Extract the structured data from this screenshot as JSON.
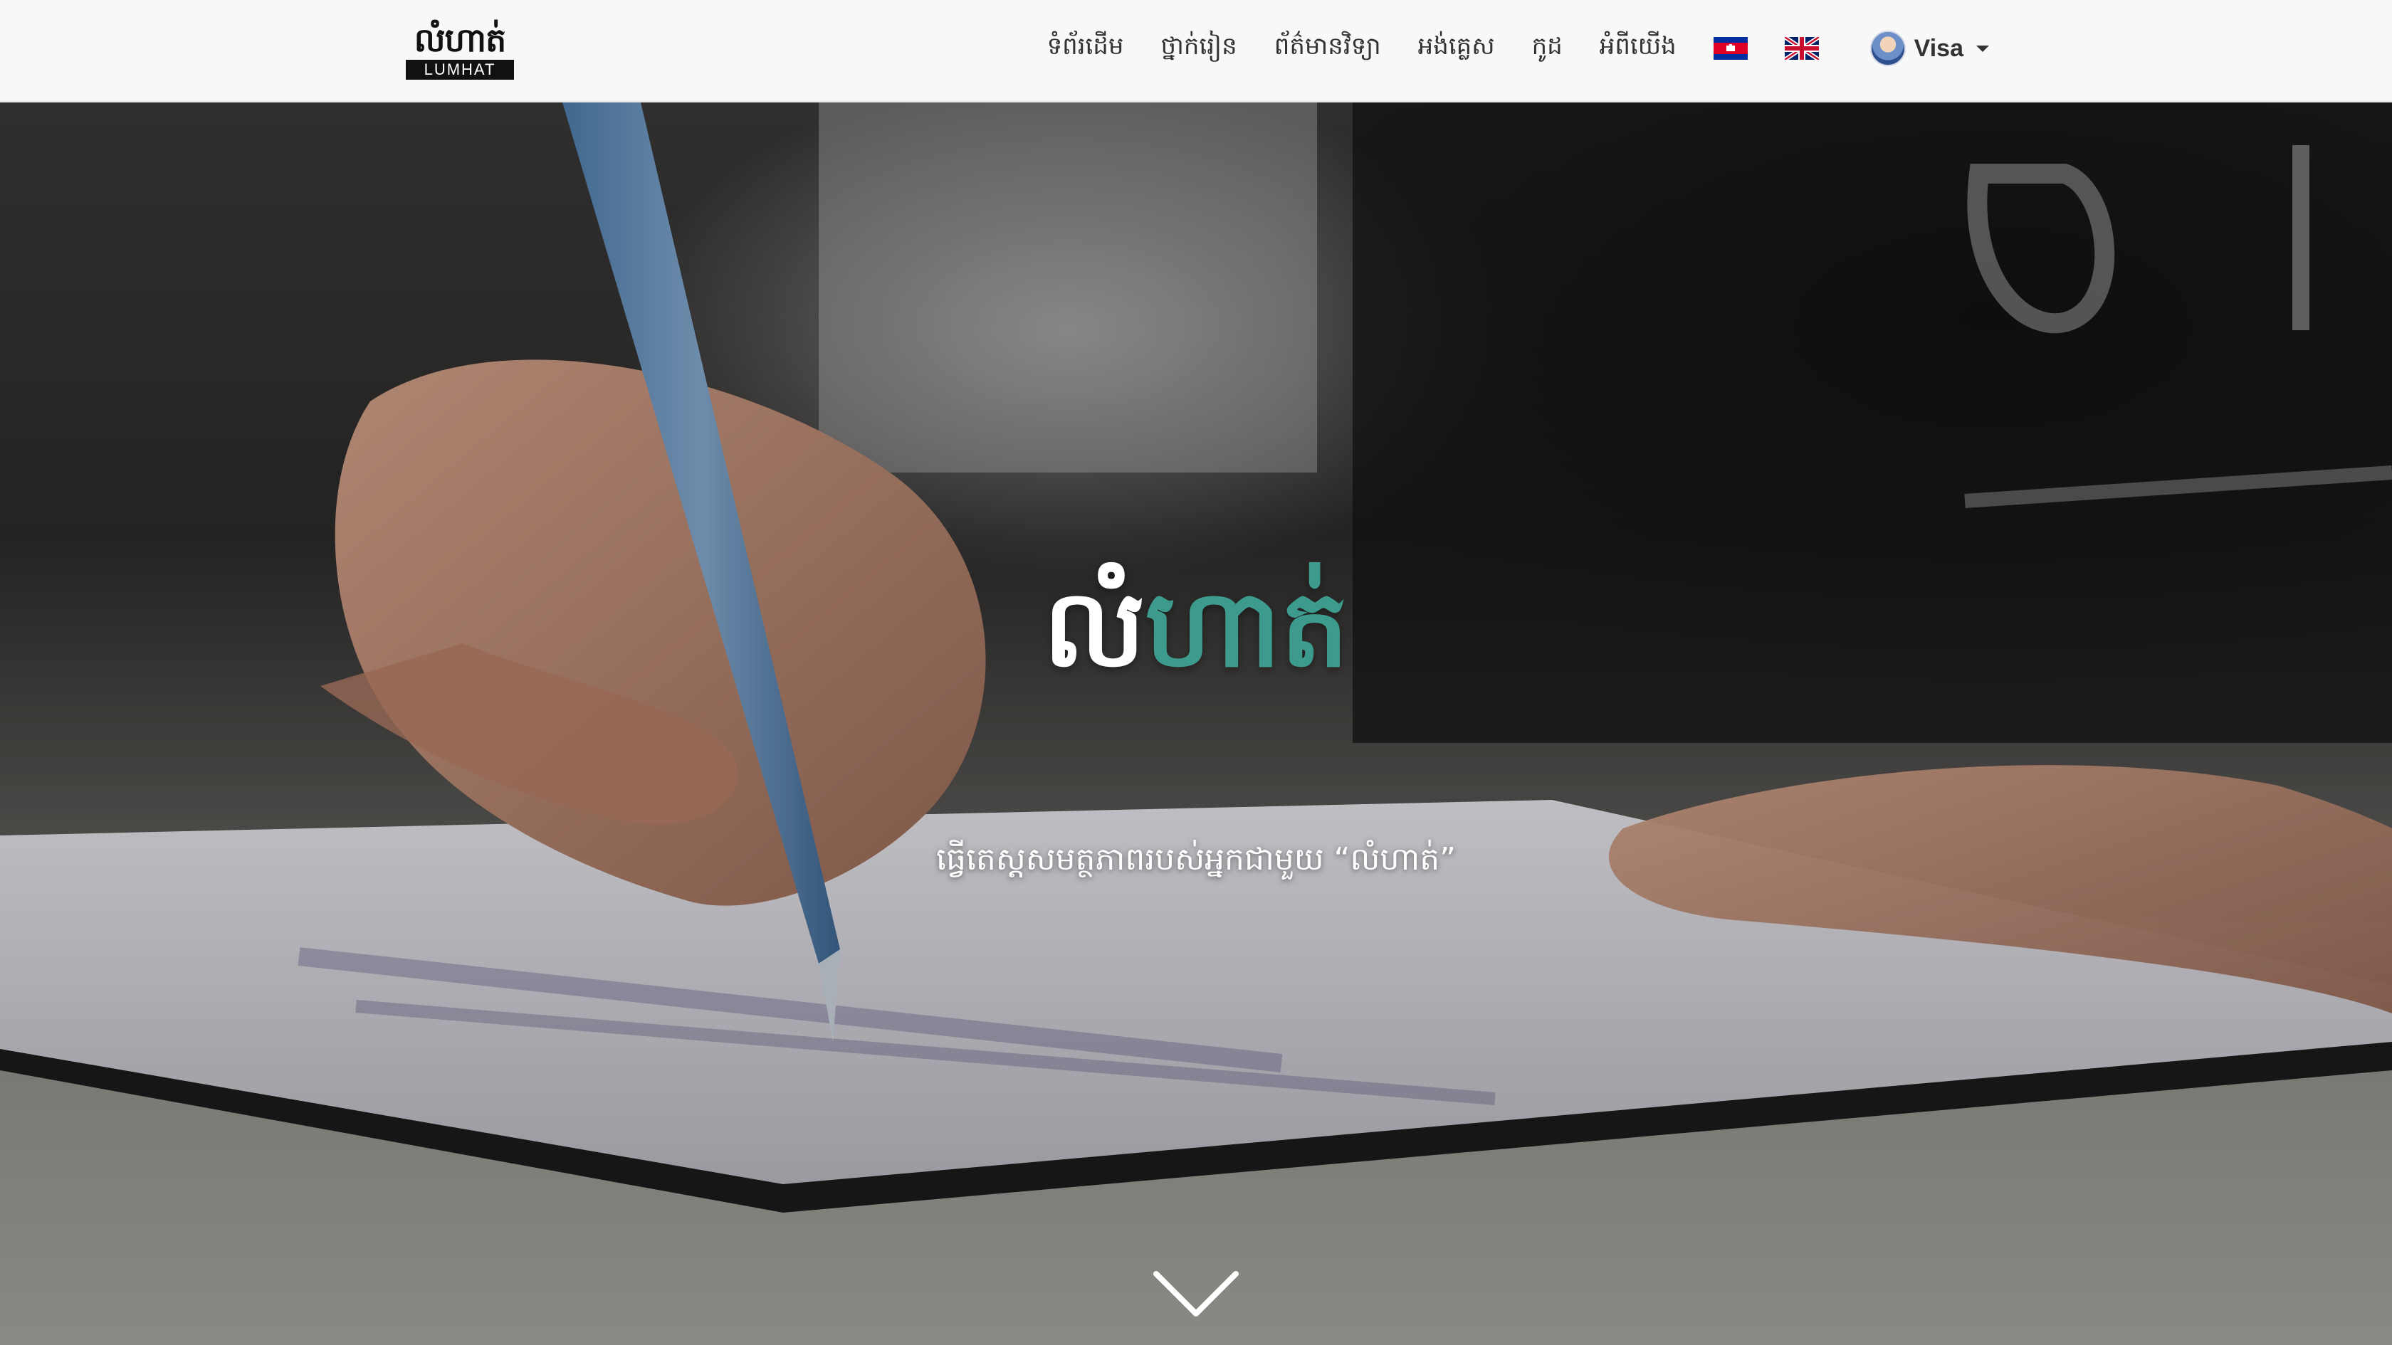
{
  "brand": {
    "logo_text": "លំហាត់",
    "logo_band": "LUMHAT"
  },
  "nav": {
    "items": [
      {
        "label": "ទំព័រដើម"
      },
      {
        "label": "ថ្នាក់រៀន"
      },
      {
        "label": "ព័ត៌មានវិទ្យា"
      },
      {
        "label": "អង់គ្លេស"
      },
      {
        "label": "កូដ"
      },
      {
        "label": "អំពីយើង"
      }
    ],
    "languages": [
      {
        "icon": "cambodia-flag-icon"
      },
      {
        "icon": "uk-flag-icon"
      }
    ],
    "user": {
      "name": "Visa",
      "icon": "chevron-down-icon"
    }
  },
  "hero": {
    "title_part1": "លំ",
    "title_part2": "ហាត់",
    "subtitle": "ធ្វើតេស្តសមត្ថភាពរបស់អ្នកជាមួយ “លំហាត់”",
    "accent_color": "#3d9b8e",
    "scroll_icon": "chevron-down-icon"
  }
}
